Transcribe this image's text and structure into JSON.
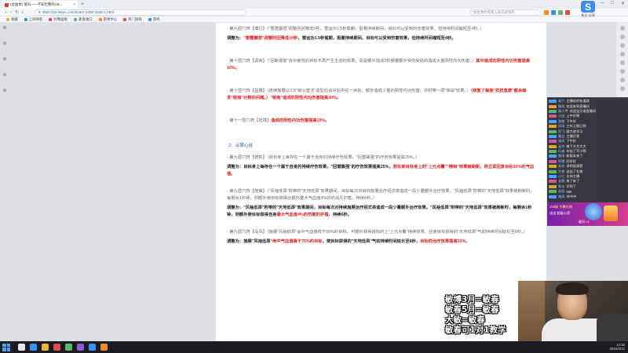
{
  "browser": {
    "tab_title": "(此副本) 蛋码——不知巨蟹的AB...",
    "new_tab": "+",
    "url": "https://p2.wpyu.com/share-2460-1525-1.html",
    "search_placeholder": "女生预约考核入驻方式领券",
    "bookmarks": [
      "收藏",
      "上网导航",
      "好像面板",
      "爱盘收口",
      "游戏中心",
      "热门游戏",
      "游戏"
    ],
    "window_controls": [
      "─",
      "□",
      "✕"
    ]
  },
  "article": {
    "blocks": [
      {
        "type": "p",
        "parts": [
          {
            "t": "· 第九层穴窍【博行】（\"雷霆震怒\"调整的回降低5秒，雷运功1.5秒偷期，挺着持续期间，目标可以受到的伤害效果，但持续时间缩短至4秒。）",
            "red": false
          }
        ]
      },
      {
        "type": "adj",
        "parts": [
          {
            "t": "调整为：",
            "red": false
          },
          {
            "t": "\"雷霆震怒\"调整的回降低10秒",
            "red": true
          },
          {
            "t": "，雷运功1.5秒偷期，挺着持续期间，目标可以受到伤害效果，但持续时间缩短至4秒。",
            "red": false
          }
        ]
      },
      {
        "type": "gap"
      },
      {
        "type": "p",
        "parts": [
          {
            "t": "· 第十层穴窍【调疾】（\"回断报复\"会中疲劳的目标不再产生主进的效果，而是额外造成2秒额量额外受伤受损的造成大量阴性内功伤害。）",
            "red": false
          },
          {
            "t": "其中造成的阴性内功伤害提高10%。",
            "red": true
          }
        ]
      },
      {
        "type": "gap"
      },
      {
        "type": "p",
        "parts": [
          {
            "t": "· 第十层穴窍【益惠】（连续施展以3次\"锁公皇法\"造型后会对后中任一目标、额外造成少量的阴性内功伤害，并附带一层\"热由\"效果。）",
            "red": false
          },
          {
            "t": "（修复了每施\"抗技急衰\"都会触发\"锐雨\"计数的问题。）\"锐雨\"造成的阴性内功伤害提高30%。",
            "red": true
          }
        ]
      },
      {
        "type": "gap"
      },
      {
        "type": "p",
        "parts": [
          {
            "t": "· 第十一层穴窍【坦境】",
            "red": false
          },
          {
            "t": "造成的阴性内功伤害提高10%。",
            "red": true
          }
        ]
      },
      {
        "type": "gap"
      },
      {
        "type": "section",
        "parts": [
          {
            "t": "2、云掌心经",
            "red": false
          }
        ]
      },
      {
        "type": "p",
        "parts": [
          {
            "t": "· 第九层穴窍【德彰】（目标身上每存在一个属于自身的持续疗伤效果，\"回雷飘强\"的疗伤效果提高25%。）",
            "red": false
          }
        ]
      },
      {
        "type": "adj",
        "parts": [
          {
            "t": "调整为：目标身上每存在一个属于自身的持续疗伤效果，\"回雷飘强\"的疗伤效果提高25%，",
            "red": false
          },
          {
            "t": "若玩家目标身上的\"上元点鬟\"\"拂雨\"效果被刷新，则立即回复目标10%的气血值。",
            "red": true
          }
        ]
      },
      {
        "type": "gap-s"
      },
      {
        "type": "p",
        "parts": [
          {
            "t": "· 第九层穴窍【挫策】（\"风袖低昂\"附带的\"天地低昂\"效果期间，目标每次对目标施展治疗招式将造成一段少量额外治疗效果，\"风袖低昂\"附带的\"天地低昂\"效果被刷新时，每剩余1秒钟，则额外使目标获得此额外量大气血值3%的的消灭护盾，持续6秒。）",
            "red": false
          }
        ]
      },
      {
        "type": "adj",
        "parts": [
          {
            "t": "调整为：\"风袖低昂\"附带的\"天地低昂\"效果期间，目标每次对持续施展治疗招式将造成一段少量额外治疗效果。\"风袖低昂\"附带的\"天地低昂\"效果被刷新时，每剩余1秒钟，则额外使目标获得自身",
            "red": false
          },
          {
            "t": "最大气血值4%的伤害的护盾",
            "red": true
          },
          {
            "t": "，持续6秒。",
            "red": false
          }
        ]
      },
      {
        "type": "gap-s"
      },
      {
        "type": "p",
        "parts": [
          {
            "t": "· 第九层穴窍【没风】（施展\"风袖低昂\"会中气血值低于50%的目标，可额外获得目标的上\"上元点鬟\"持续效果，且使目标获得的\"天地低昂\"气劲持续时间延长至8秒。）",
            "red": false
          }
        ]
      },
      {
        "type": "adj",
        "parts": [
          {
            "t": "调整为：施展\"风袖低昂\"",
            "red": false
          },
          {
            "t": "命中气血值高于75%的目标",
            "red": true
          },
          {
            "t": "，使目标获得的\"天地低昂\"气劲持续时间延长至8秒，",
            "red": false
          },
          {
            "t": "目标的治疗效果提高15%。",
            "red": true
          }
        ]
      }
    ]
  },
  "stream": {
    "logo_letter": "S",
    "logo_labels": "关注 分享",
    "chat": [
      {
        "name": "老六",
        "msg": "主播说的有道理",
        "color": "#4aa3ff"
      },
      {
        "name": "微风",
        "msg": "欢迎来到直播间",
        "color": "#e0a33a"
      },
      {
        "name": "路人甲",
        "msg": "欢迎宝贝来直播间",
        "color": "#59b86a"
      },
      {
        "name": "小白",
        "msg": "上午好啊",
        "color": "#d45a9a"
      },
      {
        "name": "游侠",
        "msg": "下午好",
        "color": "#4aa3ff"
      },
      {
        "name": "风雨",
        "msg": "三年之期已到",
        "color": "#e0a33a"
      },
      {
        "name": "阿飞",
        "msg": "跟大佬学习",
        "color": "#59b86a"
      },
      {
        "name": "墨白",
        "msg": "主播厉害",
        "color": "#4aa3ff"
      },
      {
        "name": "清风",
        "msg": "下午好",
        "color": "#d45a9a"
      },
      {
        "name": "云中",
        "msg": "拿下大大大大",
        "color": "#e0a33a"
      },
      {
        "name": "行者",
        "msg": "年轻了不少啊",
        "color": "#59b86a"
      },
      {
        "name": "夜雨",
        "msg": "新版本来了",
        "color": "#4aa3ff"
      },
      {
        "name": "阿狸",
        "msg": "好好好",
        "color": "#d45a9a"
      },
      {
        "name": "无名",
        "msg": "讲的很清楚",
        "color": "#e0a33a"
      },
      {
        "name": "大侠",
        "msg": "送出了礼物",
        "color": "#59b86a"
      },
      {
        "name": "小七",
        "msg": "支持主播",
        "color": "#4aa3ff"
      },
      {
        "name": "长歌",
        "msg": "来了来了",
        "color": "#d45a9a"
      },
      {
        "name": "秋水",
        "msg": "学到了",
        "color": "#e0a33a"
      },
      {
        "name": "北辰",
        "msg": "666",
        "color": "#59b86a"
      },
      {
        "name": "南风",
        "msg": "冲冲冲",
        "color": "#4aa3ff"
      }
    ],
    "gift": {
      "line1": "100级 专属礼物",
      "line2": "送出 超级火箭",
      "sender": "暖风 ×1"
    },
    "caption": [
      "敏博3月=敏春",
      "敏春5月=敏春",
      "大敏=敏春",
      "敏春可1对1教学"
    ]
  },
  "taskbar": {
    "time": "14:15",
    "date": "2024/3/12"
  }
}
